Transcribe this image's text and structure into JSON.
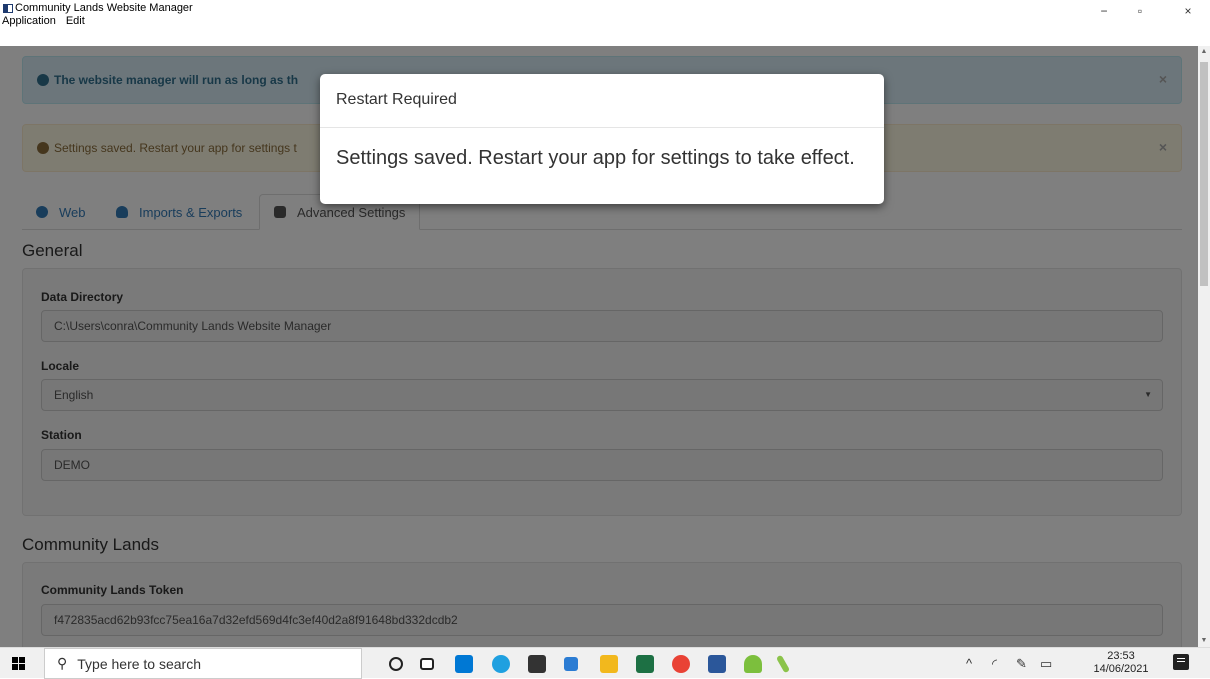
{
  "window": {
    "title": "Community Lands Website Manager",
    "menu": [
      "Application",
      "Edit"
    ],
    "controls": {
      "minimize": "−",
      "maximize": "▫",
      "close": "×"
    }
  },
  "alerts": {
    "info": "The website manager will run as long as th",
    "warn": "Settings saved. Restart your app for settings t",
    "dismiss": "×"
  },
  "tabs": [
    {
      "label": "Web",
      "icon": "globe-icon"
    },
    {
      "label": "Imports & Exports",
      "icon": "cloud-icon"
    },
    {
      "label": "Advanced Settings",
      "icon": "gears-icon",
      "active": true
    }
  ],
  "general": {
    "heading": "General",
    "data_directory_label": "Data Directory",
    "data_directory_value": "C:\\Users\\conra\\Community Lands Website Manager",
    "locale_label": "Locale",
    "locale_value": "English",
    "station_label": "Station",
    "station_value": "DEMO"
  },
  "community_lands": {
    "heading": "Community Lands",
    "token_label": "Community Lands Token",
    "token_value": "f472835acd62b93fcc75ea16a7d32efd569d4fc3ef40d2a8f91648bd332dcdb2"
  },
  "modal": {
    "title": "Restart Required",
    "body": "Settings saved. Restart your app for settings to take effect."
  },
  "taskbar": {
    "search_placeholder": "Type here to search",
    "time": "23:53",
    "date": "14/06/2021"
  },
  "colors": {
    "info_bg": "#d9edf7",
    "warn_bg": "#fcf8e3",
    "link": "#337ab7"
  }
}
